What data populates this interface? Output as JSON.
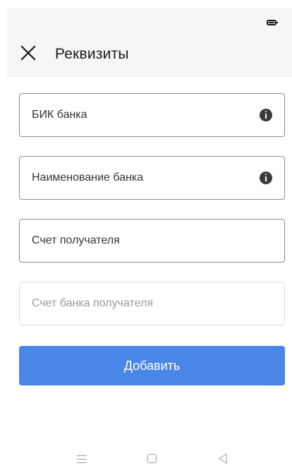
{
  "header": {
    "title": "Реквизиты"
  },
  "form": {
    "fields": [
      {
        "placeholder": "БИК банка",
        "has_info": true
      },
      {
        "placeholder": "Наименование банка",
        "has_info": true
      },
      {
        "placeholder": "Счет получателя",
        "has_info": false
      },
      {
        "placeholder": "Счет банка получателя",
        "has_info": false
      }
    ],
    "submit_label": "Добавить"
  },
  "colors": {
    "accent": "#4a86e8",
    "header_bg": "#f6f6f6"
  },
  "icons": {
    "close": "close-icon",
    "info": "info-icon",
    "battery": "battery-icon",
    "nav_menu": "menu-icon",
    "nav_home": "home-icon",
    "nav_back": "back-icon"
  }
}
